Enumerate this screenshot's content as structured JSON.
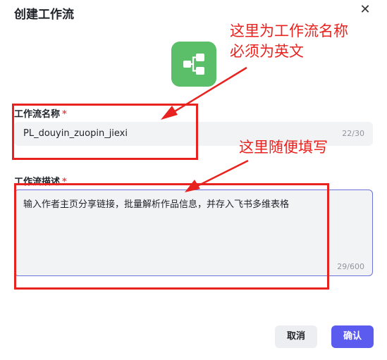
{
  "dialog": {
    "title": "创建工作流",
    "close_symbol": "✕"
  },
  "icon": {
    "name": "workflow-icon",
    "bg_color": "#5bbf6a"
  },
  "name_field": {
    "label": "工作流名称",
    "required_mark": "*",
    "value": "PL_douyin_zuopin_jiexi",
    "counter": "22/30"
  },
  "desc_field": {
    "label": "工作流描述",
    "required_mark": "*",
    "value": "输入作者主页分享链接，批量解析作品信息，并存入飞书多维表格",
    "counter": "29/600"
  },
  "buttons": {
    "cancel": "取消",
    "confirm": "确认"
  },
  "annotations": {
    "color": "#e8231f",
    "note1_line1": "这里为工作流名称",
    "note1_line2": "必须为英文",
    "note2": "这里随便填写"
  },
  "colors": {
    "accent": "#5b5bf0",
    "required": "#e5484d",
    "input_bg": "#f2f3f5"
  }
}
